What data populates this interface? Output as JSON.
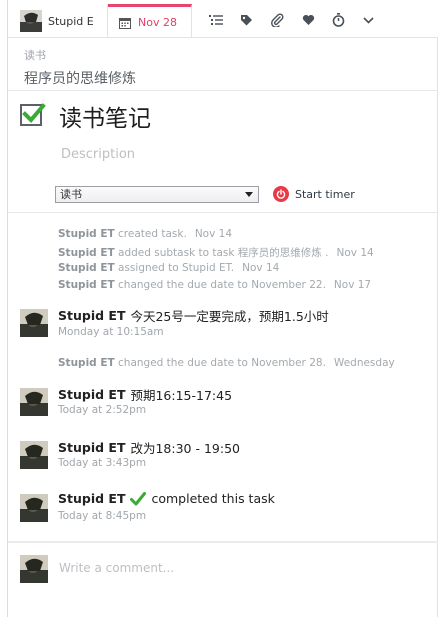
{
  "toolbar": {
    "assignee_name": "Stupid E",
    "due_date": "Nov 28",
    "icons": [
      "subtasks-icon",
      "tag-icon",
      "attachment-icon",
      "heart-icon",
      "stopwatch-icon",
      "chevron-down-icon"
    ]
  },
  "breadcrumb": {
    "parent": "读书",
    "title": "程序员的思维修炼"
  },
  "task": {
    "title": "读书笔记",
    "description_placeholder": "Description",
    "project_select": "读书",
    "timer_label": "Start timer"
  },
  "activity": [
    {
      "user": "Stupid ET",
      "text": "created task.",
      "when": "Nov 14"
    },
    {
      "user": "Stupid ET",
      "text": "added subtask to task 程序员的思维修炼 .",
      "when": "Nov 14"
    },
    {
      "user": "Stupid ET",
      "text": "assigned to Stupid ET.",
      "when": "Nov 14"
    },
    {
      "user": "Stupid ET",
      "text": "changed the due date to November 22.",
      "when": "Nov 17"
    }
  ],
  "comments": [
    {
      "user": "Stupid ET",
      "text": "今天25号一定要完成，预期1.5小时",
      "time": "Monday at 10:15am"
    },
    {
      "user": "Stupid ET",
      "text": "预期16:15-17:45",
      "time": "Today at 2:52pm"
    },
    {
      "user": "Stupid ET",
      "text": "改为18:30 - 19:50",
      "time": "Today at 3:43pm"
    },
    {
      "user": "Stupid ET",
      "text": "completed this task",
      "time": "Today at 8:45pm"
    }
  ],
  "activity_later": {
    "user": "Stupid ET",
    "text": "changed the due date to November 28.",
    "when": "Wednesday"
  },
  "composer": {
    "placeholder": "Write a comment..."
  },
  "colors": {
    "due_accent": "#e8466c",
    "check_green": "#3aa935",
    "timer_red": "#e63b47"
  }
}
